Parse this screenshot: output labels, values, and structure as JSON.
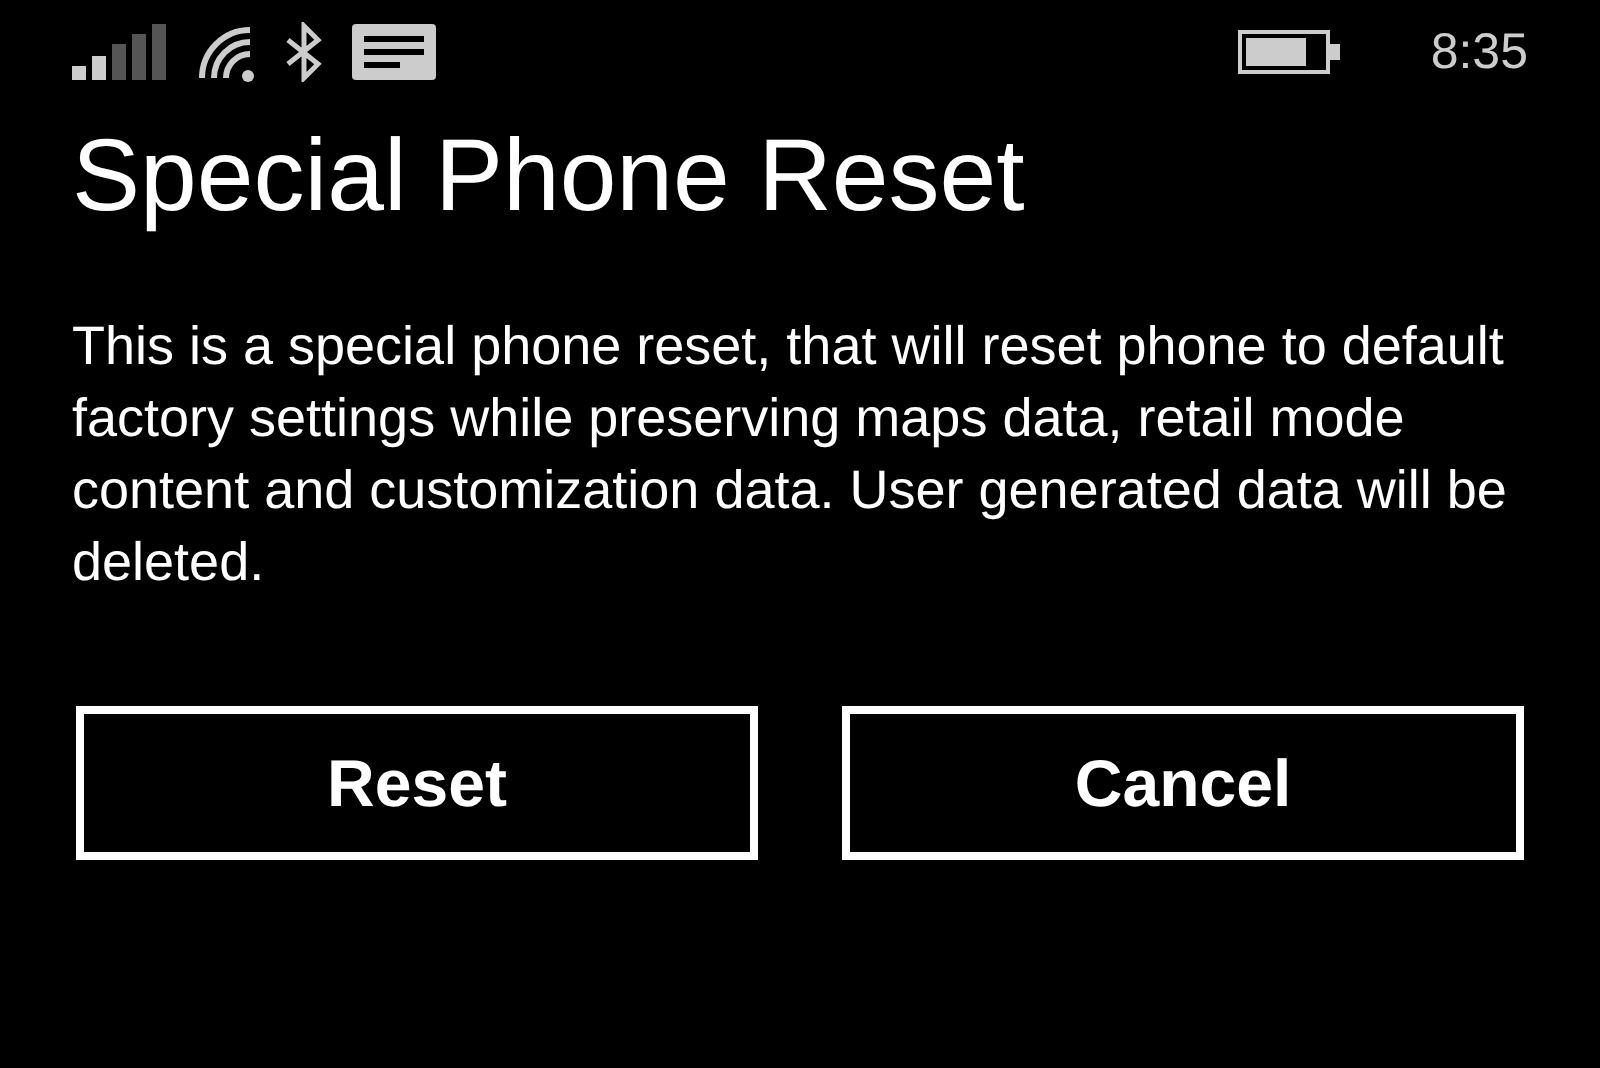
{
  "status_bar": {
    "time": "8:35"
  },
  "title": "Special Phone Reset",
  "message": "This is a special phone reset, that will reset phone to default factory settings while preserving maps data, retail mode content and customization data. User generated data will be deleted.",
  "buttons": [
    "Reset",
    "Cancel"
  ]
}
